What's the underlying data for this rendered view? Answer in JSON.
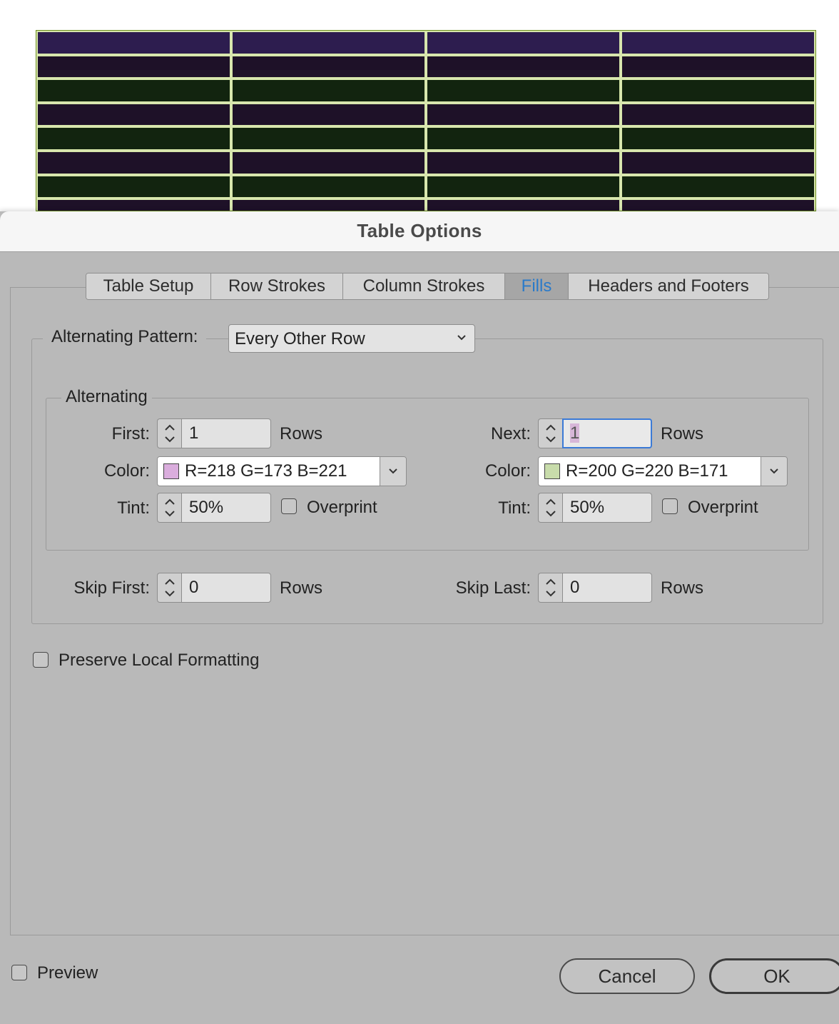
{
  "document_table": {
    "rows": [
      {
        "color": "#2d1d4f"
      },
      {
        "color": "#1e1128"
      },
      {
        "color": "#12240f"
      },
      {
        "color": "#1e1128"
      },
      {
        "color": "#12240f"
      },
      {
        "color": "#1e1128"
      },
      {
        "color": "#12240f"
      },
      {
        "color": "#1e1128"
      }
    ],
    "columns": 4,
    "border_color": "#d6e6a8"
  },
  "dialog": {
    "title": "Table Options",
    "tabs": [
      {
        "label": "Table Setup",
        "active": false
      },
      {
        "label": "Row Strokes",
        "active": false
      },
      {
        "label": "Column Strokes",
        "active": false
      },
      {
        "label": "Fills",
        "active": true
      },
      {
        "label": "Headers and Footers",
        "active": false
      }
    ],
    "alternating_pattern": {
      "label": "Alternating Pattern:",
      "value": "Every Other Row"
    },
    "alternating": {
      "caption": "Alternating",
      "first": {
        "label": "First:",
        "value": "1",
        "unit": "Rows",
        "color_label": "Color:",
        "color_value": "R=218 G=173 B=221",
        "swatch": "#daaddd",
        "tint_label": "Tint:",
        "tint_value": "50%",
        "overprint_label": "Overprint",
        "overprint_checked": false
      },
      "next": {
        "label": "Next:",
        "value": "1",
        "unit": "Rows",
        "color_label": "Color:",
        "color_value": "R=200 G=220 B=171",
        "swatch": "#c8dcab",
        "tint_label": "Tint:",
        "tint_value": "50%",
        "overprint_label": "Overprint",
        "overprint_checked": false
      }
    },
    "skip_first": {
      "label": "Skip First:",
      "value": "0",
      "unit": "Rows"
    },
    "skip_last": {
      "label": "Skip Last:",
      "value": "0",
      "unit": "Rows"
    },
    "preserve_local_formatting": {
      "label": "Preserve Local Formatting",
      "checked": false
    },
    "preview": {
      "label": "Preview",
      "checked": false
    },
    "buttons": {
      "cancel": "Cancel",
      "ok": "OK"
    },
    "colors": {
      "accent": "#2a7ac9",
      "dialog_bg": "#b9b9b9",
      "focus": "#3b7ad6"
    }
  }
}
